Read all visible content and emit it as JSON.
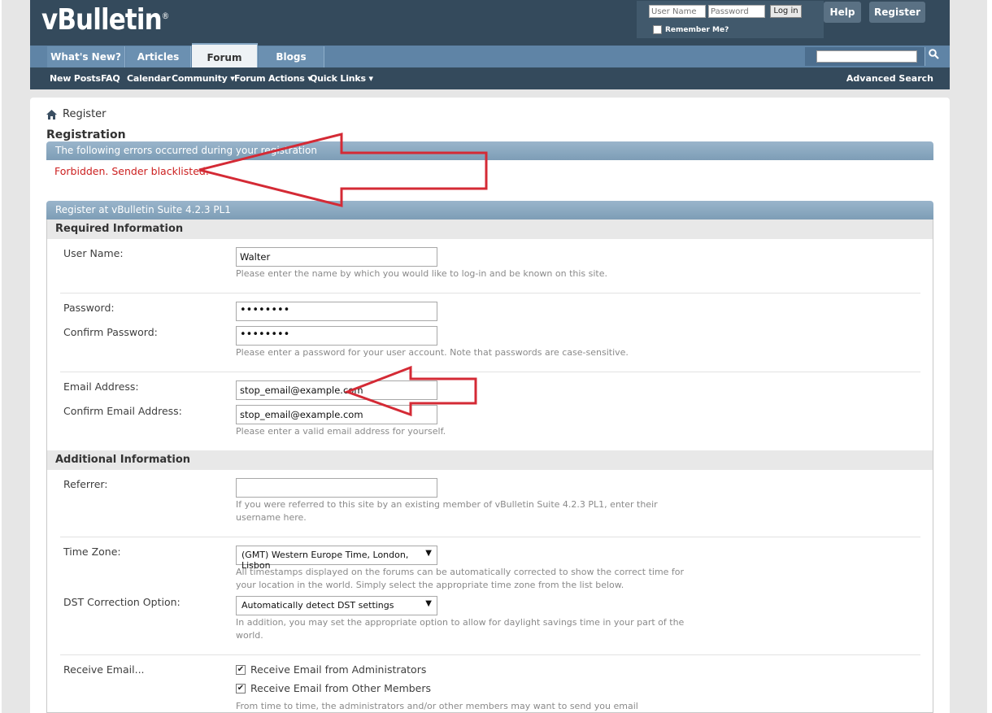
{
  "header": {
    "logo": "vBulletin",
    "logo_mark": "®",
    "login": {
      "username_placeholder": "User Name",
      "password_placeholder": "Password",
      "login_label": "Log in",
      "remember_label": "Remember Me?"
    },
    "help_label": "Help",
    "register_label": "Register"
  },
  "nav": {
    "tabs": [
      {
        "label": "What's New?"
      },
      {
        "label": "Articles"
      },
      {
        "label": "Forum"
      },
      {
        "label": "Blogs"
      }
    ],
    "active_tab": "Forum",
    "sub": [
      "New Posts",
      "FAQ",
      "Calendar",
      "Community ▾",
      "Forum Actions ▾",
      "Quick Links ▾"
    ],
    "advanced_search": "Advanced Search"
  },
  "breadcrumb": {
    "label": "Register"
  },
  "page_title": "Registration",
  "errors": {
    "heading": "The following errors occurred during your registration",
    "message": "Forbidden. Sender blacklisted."
  },
  "form": {
    "heading": "Register at vBulletin Suite 4.2.3 PL1",
    "required_heading": "Required Information",
    "username": {
      "label": "User Name:",
      "value": "Walter",
      "hint": "Please enter the name by which you would like to log-in and be known on this site."
    },
    "password": {
      "label": "Password:",
      "value": "••••••••",
      "confirm_label": "Confirm Password:",
      "confirm_value": "••••••••",
      "hint": "Please enter a password for your user account. Note that passwords are case-sensitive."
    },
    "email": {
      "label": "Email Address:",
      "value": "stop_email@example.com",
      "confirm_label": "Confirm Email Address:",
      "confirm_value": "stop_email@example.com",
      "hint": "Please enter a valid email address for yourself."
    },
    "additional_heading": "Additional Information",
    "referrer": {
      "label": "Referrer:",
      "value": "",
      "hint_1": "If you were referred to this site by an existing member of vBulletin Suite 4.2.3 PL1, enter their",
      "hint_2": "username here."
    },
    "timezone": {
      "label": "Time Zone:",
      "value": "(GMT) Western Europe Time, London, Lisbon",
      "hint_1": "All timestamps displayed on the forums can be automatically corrected to show the correct time for",
      "hint_2": "your location in the world. Simply select the appropriate time zone from the list below."
    },
    "dst": {
      "label": "DST Correction Option:",
      "value": "Automatically detect DST settings",
      "hint_1": "In addition, you may set the appropriate option to allow for daylight savings time in your part of the",
      "hint_2": "world."
    },
    "receive_email": {
      "label": "Receive Email...",
      "admin_label": "Receive Email from Administrators",
      "admin_checked": true,
      "members_label": "Receive Email from Other Members",
      "members_checked": true,
      "hint": "From time to time, the administrators and/or other members may want to send you email"
    }
  },
  "colors": {
    "header": "#344a5c",
    "nav": "#5f84a6",
    "error": "#cc1f1f",
    "annotation": "#d42a35"
  },
  "icons": [
    "home-icon",
    "search-icon",
    "dropdown-arrow-icon",
    "checkbox-checked-icon"
  ]
}
